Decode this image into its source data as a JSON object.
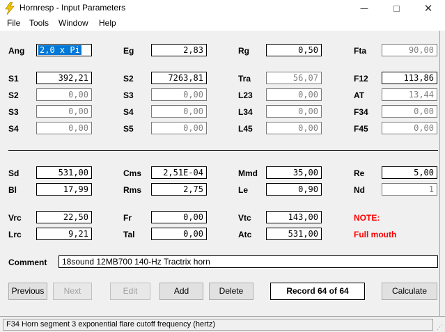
{
  "window": {
    "title": "Hornresp - Input Parameters",
    "minimize": "—",
    "close": "✕"
  },
  "menu": {
    "file": "File",
    "tools": "Tools",
    "window": "Window",
    "help": "Help"
  },
  "rows": {
    "ang": {
      "label": "Ang",
      "value": "2,0 x Pi"
    },
    "eg": {
      "label": "Eg",
      "value": "2,83"
    },
    "rg": {
      "label": "Rg",
      "value": "0,50"
    },
    "fta": {
      "label": "Fta",
      "value": "90,00"
    },
    "s1": {
      "label": "S1",
      "value": "392,21"
    },
    "s2": {
      "label": "S2",
      "value": "7263,81"
    },
    "tra": {
      "label": "Tra",
      "value": "56,07"
    },
    "f12": {
      "label": "F12",
      "value": "113,86"
    },
    "s2b": {
      "label": "S2",
      "value": "0,00"
    },
    "s3": {
      "label": "S3",
      "value": "0,00"
    },
    "l23": {
      "label": "L23",
      "value": "0,00"
    },
    "at": {
      "label": "AT",
      "value": "13,44"
    },
    "s3b": {
      "label": "S3",
      "value": "0,00"
    },
    "s4": {
      "label": "S4",
      "value": "0,00"
    },
    "l34": {
      "label": "L34",
      "value": "0,00"
    },
    "f34": {
      "label": "F34",
      "value": "0,00"
    },
    "s4b": {
      "label": "S4",
      "value": "0,00"
    },
    "s5": {
      "label": "S5",
      "value": "0,00"
    },
    "l45": {
      "label": "L45",
      "value": "0,00"
    },
    "f45": {
      "label": "F45",
      "value": "0,00"
    },
    "sd": {
      "label": "Sd",
      "value": "531,00"
    },
    "cms": {
      "label": "Cms",
      "value": "2,51E-04"
    },
    "mmd": {
      "label": "Mmd",
      "value": "35,00"
    },
    "re": {
      "label": "Re",
      "value": "5,00"
    },
    "bl": {
      "label": "Bl",
      "value": "17,99"
    },
    "rms": {
      "label": "Rms",
      "value": "2,75"
    },
    "le": {
      "label": "Le",
      "value": "0,90"
    },
    "nd": {
      "label": "Nd",
      "value": "1"
    },
    "vrc": {
      "label": "Vrc",
      "value": "22,50"
    },
    "fr": {
      "label": "Fr",
      "value": "0,00"
    },
    "vtc": {
      "label": "Vtc",
      "value": "143,00"
    },
    "lrc": {
      "label": "Lrc",
      "value": "9,21"
    },
    "tal": {
      "label": "Tal",
      "value": "0,00"
    },
    "atc": {
      "label": "Atc",
      "value": "531,00"
    }
  },
  "note": {
    "title": "NOTE:",
    "text": "Full mouth",
    "color": "#ff0000"
  },
  "comment": {
    "label": "Comment",
    "value": "18sound 12MB700 140-Hz Tractrix horn"
  },
  "buttons": {
    "previous": "Previous",
    "next": "Next",
    "edit": "Edit",
    "add": "Add",
    "delete": "Delete",
    "calculate": "Calculate"
  },
  "record": "Record 64 of 64",
  "status": "F34   Horn segment 3 exponential flare cutoff frequency  (hertz)",
  "colors": {
    "selection": "#0078d7",
    "icon": "#f5c400"
  }
}
